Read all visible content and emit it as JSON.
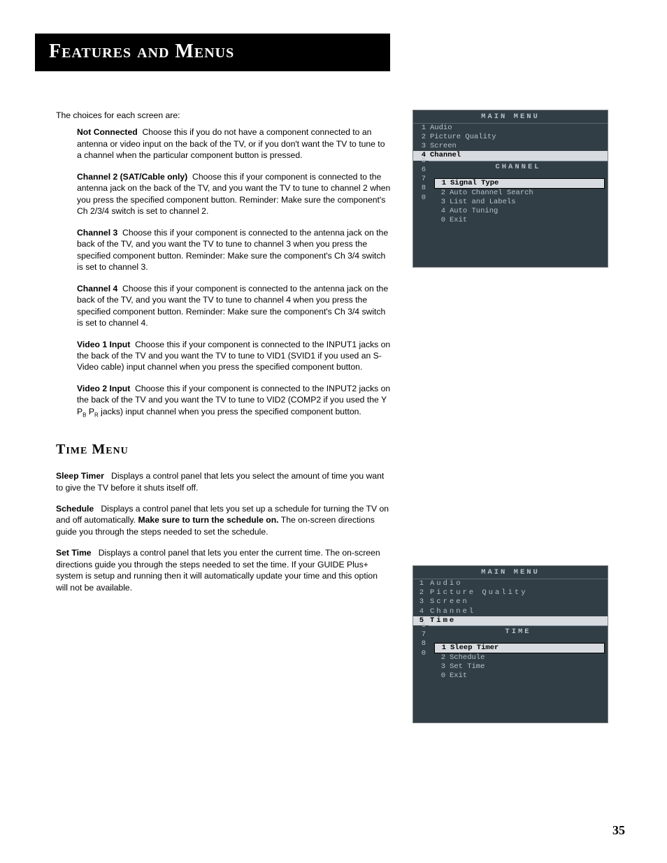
{
  "title": "Features and Menus",
  "intro": "The choices for each screen are:",
  "choices": [
    {
      "label": "Not Connected",
      "text": "Choose this if you do not have a component connected to an antenna or video input on the back of the TV, or if you don't want the TV to tune to a channel when the particular component button is pressed."
    },
    {
      "label": "Channel 2 (SAT/Cable only)",
      "text": "Choose this if your component is connected to the antenna jack on the back of the TV, and you want the TV to tune to channel 2 when you press the specified component button. Reminder: Make sure the component's Ch 2/3/4 switch is set to channel 2."
    },
    {
      "label": "Channel 3",
      "text": "Choose this if your component is connected to the antenna jack on the back of the TV, and you want the TV to tune to channel 3 when you press the specified component button. Reminder: Make sure the component's Ch 3/4 switch is set to channel 3."
    },
    {
      "label": "Channel 4",
      "text": "Choose this if your component is connected to the antenna jack on the back of the TV, and you want the TV to tune to channel 4 when you press the specified component button. Reminder: Make sure the component's Ch 3/4 switch is set to channel 4."
    },
    {
      "label": "Video 1 Input",
      "text": "Choose this if your component is connected to the INPUT1 jacks on the back of the TV and you want the TV to tune to VID1 (SVID1 if you used an S-Video cable) input channel when you press the specified component button."
    },
    {
      "label": "Video 2 Input",
      "text_pre": "Choose this if your component is connected to the INPUT2 jacks on the back of the TV and you want the TV to tune to VID2 (COMP2 if you used the Y P",
      "sub1": "B",
      "mid": " P",
      "sub2": "R",
      "text_post": " jacks) input channel when you press the specified component button."
    }
  ],
  "section2": {
    "heading": "Time Menu",
    "items": [
      {
        "label": "Sleep Timer",
        "text": "Displays a control panel that lets you select the amount of time you want to give the TV before it shuts itself off."
      },
      {
        "label": "Schedule",
        "text_pre": "Displays a control panel that lets you set up a schedule for turning the TV on and off automatically. ",
        "bold": "Make sure to turn the schedule on.",
        "text_post": " The on-screen directions guide you through the steps needed to set the schedule."
      },
      {
        "label": "Set Time",
        "text": "Displays a control panel that lets you enter the current time. The on-screen directions guide you through the steps needed to set the time. If your GUIDE Plus+ system is setup and running then it will automatically update your time and this option will not be available."
      }
    ]
  },
  "menu1": {
    "title": "MAIN MENU",
    "items": [
      {
        "num": "1",
        "label": "Audio"
      },
      {
        "num": "2",
        "label": "Picture Quality"
      },
      {
        "num": "3",
        "label": "Screen"
      },
      {
        "num": "4",
        "label": "Channel",
        "selected": true
      }
    ],
    "left_nums": [
      "5",
      "6",
      "7",
      "8",
      "0"
    ],
    "sub_title": "CHANNEL",
    "sub_items": [
      {
        "num": "1",
        "label": "Signal Type",
        "selected": true
      },
      {
        "num": "2",
        "label": "Auto Channel Search"
      },
      {
        "num": "3",
        "label": "List and Labels"
      },
      {
        "num": "4",
        "label": "Auto Tuning"
      },
      {
        "num": "0",
        "label": "Exit"
      }
    ]
  },
  "menu2": {
    "title": "MAIN MENU",
    "items": [
      {
        "num": "1",
        "label": "Audio"
      },
      {
        "num": "2",
        "label": "Picture Quality"
      },
      {
        "num": "3",
        "label": "Screen"
      },
      {
        "num": "4",
        "label": "Channel"
      },
      {
        "num": "5",
        "label": "Time",
        "selected": true
      }
    ],
    "left_nums": [
      "6",
      "7",
      "8",
      "0"
    ],
    "sub_title": "TIME",
    "sub_items": [
      {
        "num": "1",
        "label": "Sleep Timer",
        "selected": true
      },
      {
        "num": "2",
        "label": "Schedule"
      },
      {
        "num": "3",
        "label": "Set Time"
      },
      {
        "num": "0",
        "label": "Exit"
      }
    ]
  },
  "page_number": "35"
}
